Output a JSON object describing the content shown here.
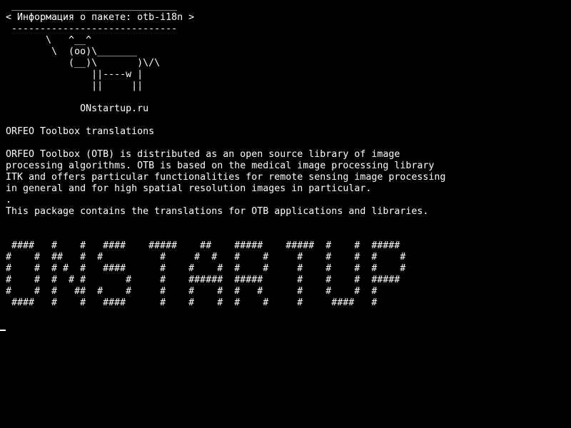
{
  "terminal": {
    "lines": [
      " _____________________________",
      "< Информация о пакете: otb-i18n >",
      " -----------------------------",
      "       \\   ^__^",
      "        \\  (oo)\\_______",
      "           (__)\\       )\\/\\",
      "               ||----w |",
      "               ||     ||",
      "",
      "             ONstartup.ru",
      "",
      "ORFEO Toolbox translations",
      "",
      "ORFEO Toolbox (OTB) is distributed as an open source library of image",
      "processing algorithms. OTB is based on the medical image processing library",
      "ITK and offers particular functionalities for remote sensing image processing",
      "in general and for high spatial resolution images in particular.",
      ".",
      "This package contains the translations for OTB applications and libraries.",
      "",
      "",
      " ####   #    #   ####    #####    ##    #####    #####  #    #  #####",
      "#    #  ##   #  #          #     #  #   #    #     #    #    #  #    #",
      "#    #  # #  #   ####      #    #    #  #    #     #    #    #  #    #",
      "#    #  #  # #       #     #    ######  #####      #    #    #  #####",
      "#    #  #   ##  #    #     #    #    #  #   #      #    #    #  #",
      " ####   #    #   ####      #    #    #  #    #     #     ####   #"
    ],
    "cursor": "_"
  }
}
